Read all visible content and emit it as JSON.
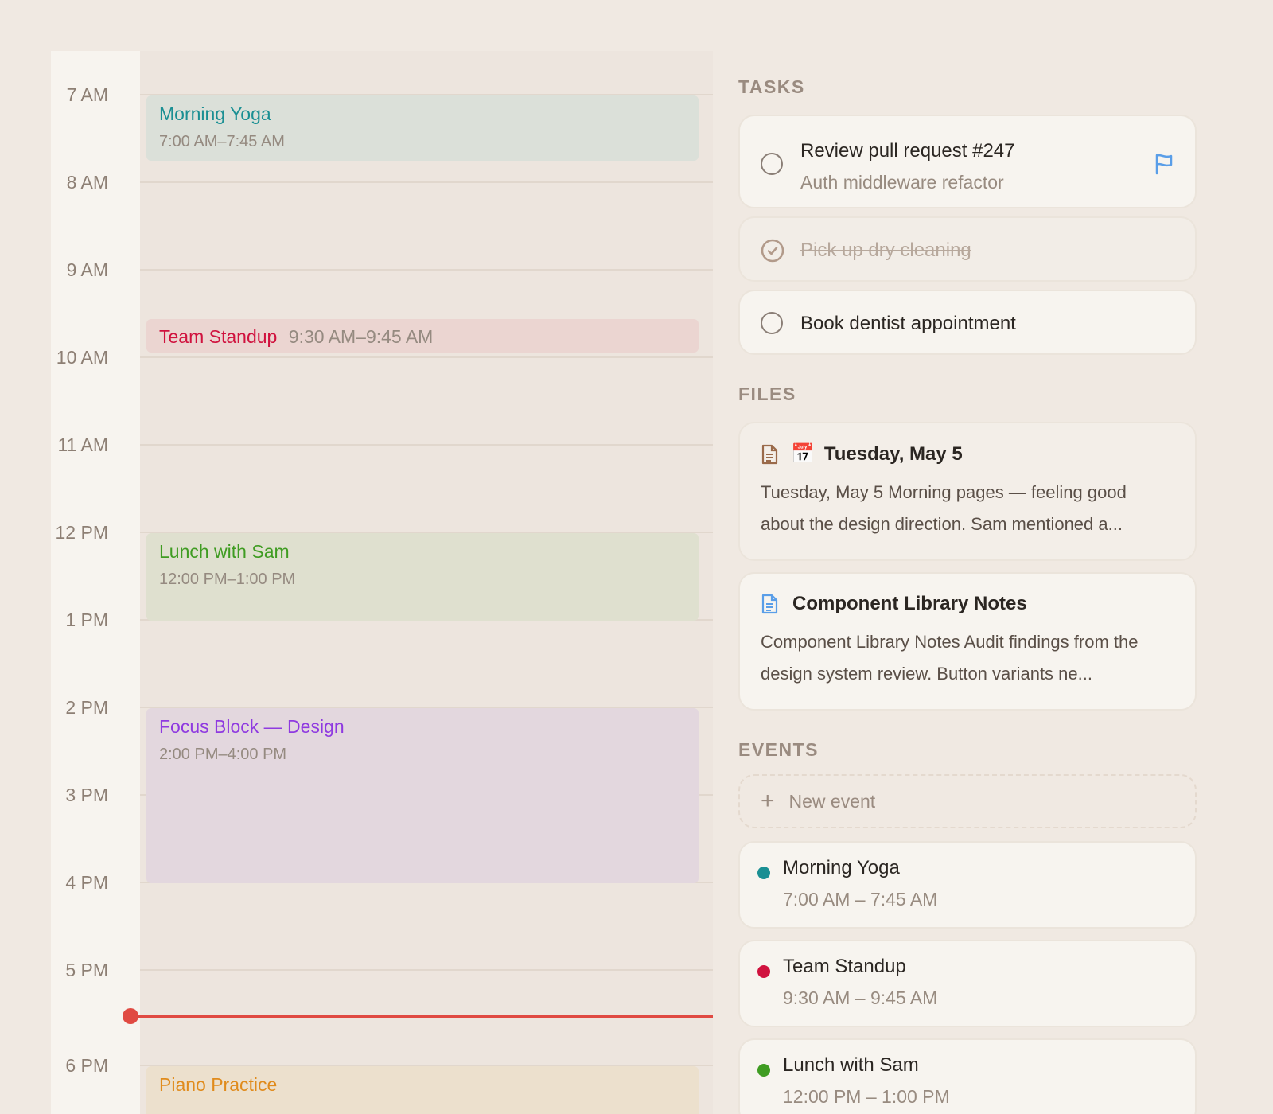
{
  "calendar": {
    "hours": [
      "7 AM",
      "8 AM",
      "9 AM",
      "10 AM",
      "11 AM",
      "12 PM",
      "1 PM",
      "2 PM",
      "3 PM",
      "4 PM",
      "5 PM",
      "6 PM"
    ],
    "events": [
      {
        "title": "Morning Yoga",
        "time": "7:00 AM–7:45 AM",
        "color": "#1a8f93",
        "bg": "#dbe0d9"
      },
      {
        "title": "Team Standup",
        "time": "9:30 AM–9:45 AM",
        "color": "#d0123e",
        "bg": "#ebd5d1"
      },
      {
        "title": "Lunch with Sam",
        "time": "12:00 PM–1:00 PM",
        "color": "#3f9c22",
        "bg": "#dfe0cf"
      },
      {
        "title": "Focus Block — Design",
        "time": "2:00 PM–4:00 PM",
        "color": "#8f3ae0",
        "bg": "#e3d7de"
      },
      {
        "title": "Piano Practice",
        "time": "",
        "color": "#e08b1c",
        "bg": "#ece0cd"
      }
    ],
    "current_time_color": "#e04a42"
  },
  "tasks": {
    "heading": "TASKS",
    "items": [
      {
        "title": "Review pull request #247",
        "subtitle": "Auth middleware refactor",
        "done": false,
        "flag": "flag-icon"
      },
      {
        "title": "Pick up dry cleaning",
        "done": true
      },
      {
        "title": "Book dentist appointment",
        "done": false
      }
    ]
  },
  "files": {
    "heading": "FILES",
    "items": [
      {
        "emoji": "📅",
        "title": "Tuesday, May 5",
        "body": "Tuesday, May 5 Morning pages — feeling good about the design direction. Sam mentioned a...",
        "icon": "document-icon"
      },
      {
        "title": "Component Library Notes",
        "body": "Component Library Notes Audit findings from the design system review. Button variants ne...",
        "icon": "document-icon"
      }
    ]
  },
  "events": {
    "heading": "EVENTS",
    "new_event_label": "New event",
    "items": [
      {
        "title": "Morning Yoga",
        "time": "7:00 AM – 7:45 AM",
        "color": "#1a8f93"
      },
      {
        "title": "Team Standup",
        "time": "9:30 AM – 9:45 AM",
        "color": "#d0123e"
      },
      {
        "title": "Lunch with Sam",
        "time": "12:00 PM – 1:00 PM",
        "color": "#3f9c22"
      }
    ]
  }
}
